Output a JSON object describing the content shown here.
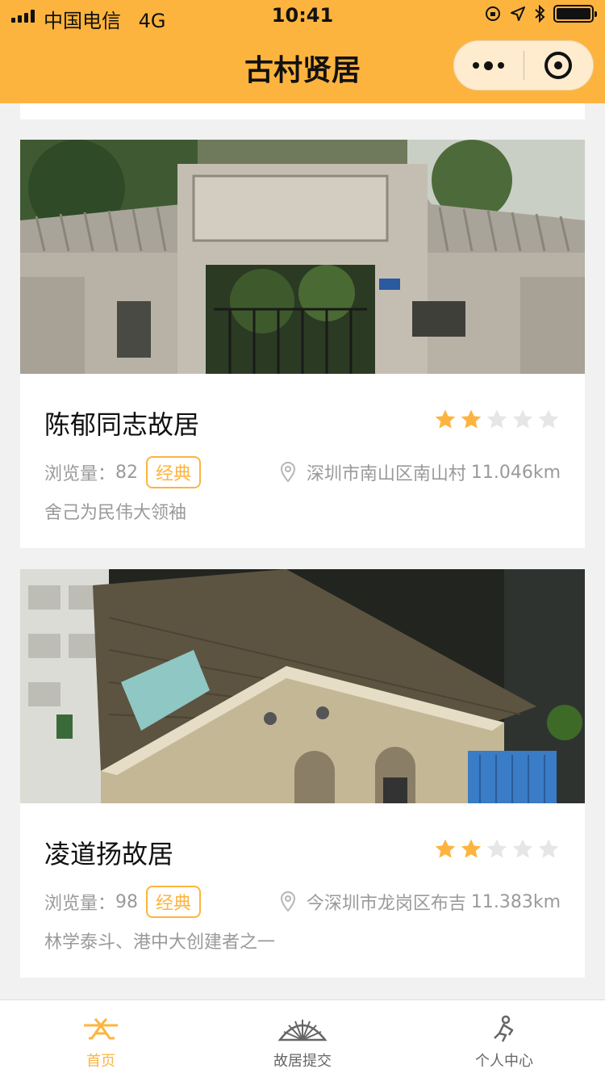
{
  "status_bar": {
    "carrier": "中国电信",
    "network": "4G",
    "time": "10:41"
  },
  "nav": {
    "title": "古村贤居"
  },
  "cards": [
    {
      "title": "陈郁同志故居",
      "rating": 2,
      "rating_max": 5,
      "views_label": "浏览量：",
      "views": "82",
      "tag": "经典",
      "address": "深圳市南山区南山村",
      "distance": "11.046km",
      "description": "舍己为民伟大领袖"
    },
    {
      "title": "凌道扬故居",
      "rating": 2,
      "rating_max": 5,
      "views_label": "浏览量：",
      "views": "98",
      "tag": "经典",
      "address": "今深圳市龙岗区布吉",
      "distance": "11.383km",
      "description": "林学泰斗、港中大创建者之一"
    }
  ],
  "tabbar": {
    "items": [
      {
        "label": "首页",
        "icon": "home-roof-icon",
        "active": true
      },
      {
        "label": "故居提交",
        "icon": "fan-icon",
        "active": false
      },
      {
        "label": "个人中心",
        "icon": "person-icon",
        "active": false
      }
    ]
  },
  "colors": {
    "brand": "#fdb43f",
    "star_on": "#fdb43f",
    "star_off": "#e6e6e6",
    "muted_text": "#9a9a9a"
  }
}
